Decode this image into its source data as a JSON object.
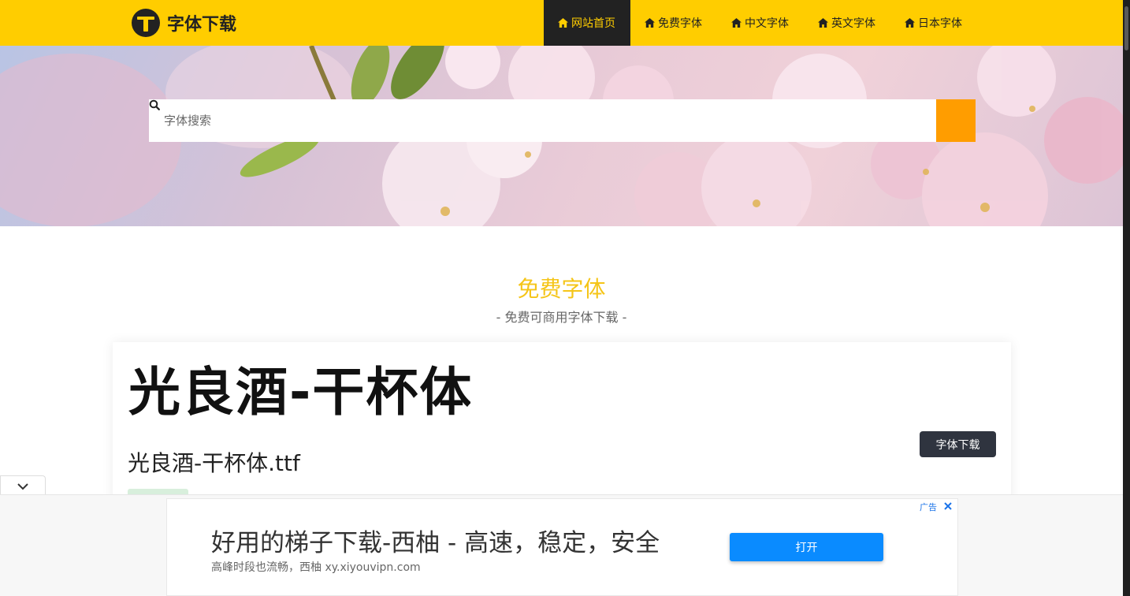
{
  "header": {
    "logo_text": "字体下载",
    "nav": [
      {
        "label": "网站首页",
        "active": true
      },
      {
        "label": "免费字体",
        "active": false
      },
      {
        "label": "中文字体",
        "active": false
      },
      {
        "label": "英文字体",
        "active": false
      },
      {
        "label": "日本字体",
        "active": false
      }
    ]
  },
  "search": {
    "placeholder": "字体搜索"
  },
  "section": {
    "title": "免费字体",
    "subtitle": "- 免费可商用字体下载 -"
  },
  "card": {
    "preview_text": "光良酒-干杯体",
    "font_name": "光良酒-干杯体.ttf",
    "download_label": "字体下载"
  },
  "ad": {
    "label": "广告",
    "headline": "好用的梯子下载-西柚 - 高速，稳定，安全",
    "url_text": "高峰时段也流畅，西柚 xy.xiyouvipn.com",
    "open_label": "打开"
  },
  "colors": {
    "header_yellow": "#ffcd00",
    "nav_active_bg": "#222222",
    "search_button": "#ff9d00",
    "section_title": "#f5c518",
    "download_button": "#2f343f",
    "ad_open_button": "#0a8bff"
  },
  "icons": {
    "logo": "t-logo-icon",
    "nav": "home-icon",
    "search": "search-icon",
    "collapse": "chevron-down-icon",
    "ad_close": "close-icon"
  }
}
